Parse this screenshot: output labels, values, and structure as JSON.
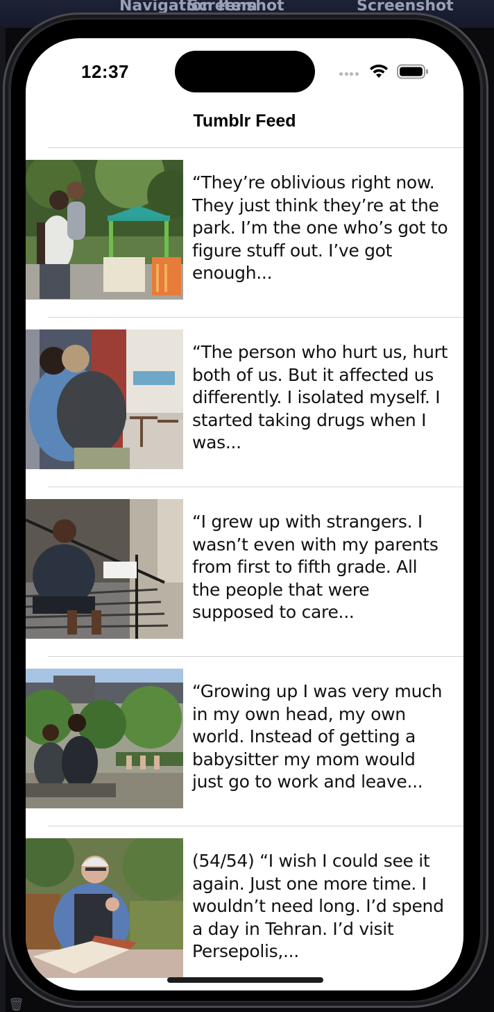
{
  "simulator": {
    "header_labels": [
      "Navigation Item",
      "Screenshot",
      "Screenshot"
    ]
  },
  "status_bar": {
    "time": "12:37"
  },
  "nav": {
    "title": "Tumblr Feed"
  },
  "feed": {
    "items": [
      {
        "text": "“They’re oblivious right now. They just think they’re at the park. I’m the one who’s got to figure stuff out. I’ve got enough..."
      },
      {
        "text": "“The person who hurt us, hurt both of us. But it affected us differently. I isolated myself. I started taking drugs when I was..."
      },
      {
        "text": "“I grew up with strangers. I wasn’t even with my parents from first to fifth grade. All the people that were supposed to care..."
      },
      {
        "text": "“Growing up I was very much in my own head, my own world. Instead of getting a babysitter my mom would just go to work and leave..."
      },
      {
        "text": "(54/54) “I wish I could see it again. Just one more time. I wouldn’t need long. I’d spend a day in Tehran. I’d visit Persepolis,..."
      }
    ]
  },
  "colors": {
    "screen_bg": "#ffffff",
    "divider": "#d4d4d8",
    "text": "#111111"
  }
}
